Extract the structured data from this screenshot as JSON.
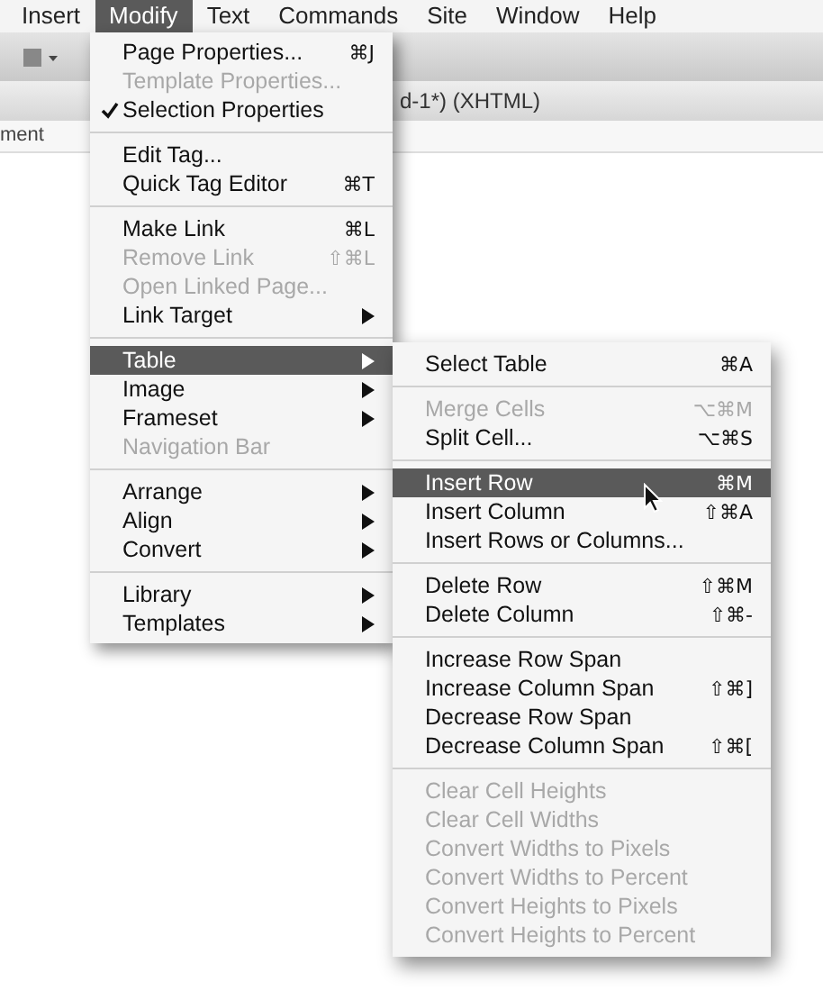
{
  "menubar": [
    {
      "label": "Insert",
      "selected": false
    },
    {
      "label": "Modify",
      "selected": true
    },
    {
      "label": "Text",
      "selected": false
    },
    {
      "label": "Commands",
      "selected": false
    },
    {
      "label": "Site",
      "selected": false
    },
    {
      "label": "Window",
      "selected": false
    },
    {
      "label": "Help",
      "selected": false
    }
  ],
  "document": {
    "title_fragment": "d-1*) (XHTML)",
    "panel_fragment": "ment"
  },
  "modify_menu": [
    {
      "kind": "item",
      "label": "Page Properties...",
      "shortcut": "⌘J",
      "disabled": false,
      "checked": false,
      "submenu": false,
      "selected": false
    },
    {
      "kind": "item",
      "label": "Template Properties...",
      "disabled": true,
      "checked": false,
      "submenu": false,
      "selected": false
    },
    {
      "kind": "item",
      "label": "Selection Properties",
      "disabled": false,
      "checked": true,
      "submenu": false,
      "selected": false
    },
    {
      "kind": "separator"
    },
    {
      "kind": "item",
      "label": "Edit Tag...",
      "disabled": false,
      "checked": false,
      "submenu": false,
      "selected": false
    },
    {
      "kind": "item",
      "label": "Quick Tag Editor",
      "shortcut": "⌘T",
      "disabled": false,
      "checked": false,
      "submenu": false,
      "selected": false
    },
    {
      "kind": "separator"
    },
    {
      "kind": "item",
      "label": "Make Link",
      "shortcut": "⌘L",
      "disabled": false,
      "checked": false,
      "submenu": false,
      "selected": false
    },
    {
      "kind": "item",
      "label": "Remove Link",
      "shortcut": "⇧⌘L",
      "disabled": true,
      "checked": false,
      "submenu": false,
      "selected": false
    },
    {
      "kind": "item",
      "label": "Open Linked Page...",
      "disabled": true,
      "checked": false,
      "submenu": false,
      "selected": false
    },
    {
      "kind": "item",
      "label": "Link Target",
      "disabled": false,
      "checked": false,
      "submenu": true,
      "selected": false
    },
    {
      "kind": "separator"
    },
    {
      "kind": "item",
      "label": "Table",
      "disabled": false,
      "checked": false,
      "submenu": true,
      "selected": true
    },
    {
      "kind": "item",
      "label": "Image",
      "disabled": false,
      "checked": false,
      "submenu": true,
      "selected": false
    },
    {
      "kind": "item",
      "label": "Frameset",
      "disabled": false,
      "checked": false,
      "submenu": true,
      "selected": false
    },
    {
      "kind": "item",
      "label": "Navigation Bar",
      "disabled": true,
      "checked": false,
      "submenu": false,
      "selected": false
    },
    {
      "kind": "separator"
    },
    {
      "kind": "item",
      "label": "Arrange",
      "disabled": false,
      "checked": false,
      "submenu": true,
      "selected": false
    },
    {
      "kind": "item",
      "label": "Align",
      "disabled": false,
      "checked": false,
      "submenu": true,
      "selected": false
    },
    {
      "kind": "item",
      "label": "Convert",
      "disabled": false,
      "checked": false,
      "submenu": true,
      "selected": false
    },
    {
      "kind": "separator"
    },
    {
      "kind": "item",
      "label": "Library",
      "disabled": false,
      "checked": false,
      "submenu": true,
      "selected": false
    },
    {
      "kind": "item",
      "label": "Templates",
      "disabled": false,
      "checked": false,
      "submenu": true,
      "selected": false
    }
  ],
  "table_submenu": [
    {
      "kind": "item",
      "label": "Select Table",
      "shortcut": "⌘A",
      "disabled": false,
      "selected": false
    },
    {
      "kind": "separator"
    },
    {
      "kind": "item",
      "label": "Merge Cells",
      "shortcut": "⌥⌘M",
      "disabled": true,
      "selected": false
    },
    {
      "kind": "item",
      "label": "Split Cell...",
      "shortcut": "⌥⌘S",
      "disabled": false,
      "selected": false
    },
    {
      "kind": "separator"
    },
    {
      "kind": "item",
      "label": "Insert Row",
      "shortcut": "⌘M",
      "disabled": false,
      "selected": true
    },
    {
      "kind": "item",
      "label": "Insert Column",
      "shortcut": "⇧⌘A",
      "disabled": false,
      "selected": false
    },
    {
      "kind": "item",
      "label": "Insert Rows or Columns...",
      "disabled": false,
      "selected": false
    },
    {
      "kind": "separator"
    },
    {
      "kind": "item",
      "label": "Delete Row",
      "shortcut": "⇧⌘M",
      "disabled": false,
      "selected": false
    },
    {
      "kind": "item",
      "label": "Delete Column",
      "shortcut": "⇧⌘-",
      "disabled": false,
      "selected": false
    },
    {
      "kind": "separator"
    },
    {
      "kind": "item",
      "label": "Increase Row Span",
      "disabled": false,
      "selected": false
    },
    {
      "kind": "item",
      "label": "Increase Column Span",
      "shortcut": "⇧⌘]",
      "disabled": false,
      "selected": false
    },
    {
      "kind": "item",
      "label": "Decrease Row Span",
      "disabled": false,
      "selected": false
    },
    {
      "kind": "item",
      "label": "Decrease Column Span",
      "shortcut": "⇧⌘[",
      "disabled": false,
      "selected": false
    },
    {
      "kind": "separator"
    },
    {
      "kind": "item",
      "label": "Clear Cell Heights",
      "disabled": true,
      "selected": false
    },
    {
      "kind": "item",
      "label": "Clear Cell Widths",
      "disabled": true,
      "selected": false
    },
    {
      "kind": "item",
      "label": "Convert Widths to Pixels",
      "disabled": true,
      "selected": false
    },
    {
      "kind": "item",
      "label": "Convert Widths to Percent",
      "disabled": true,
      "selected": false
    },
    {
      "kind": "item",
      "label": "Convert Heights to Pixels",
      "disabled": true,
      "selected": false
    },
    {
      "kind": "item",
      "label": "Convert Heights to Percent",
      "disabled": true,
      "selected": false
    }
  ]
}
